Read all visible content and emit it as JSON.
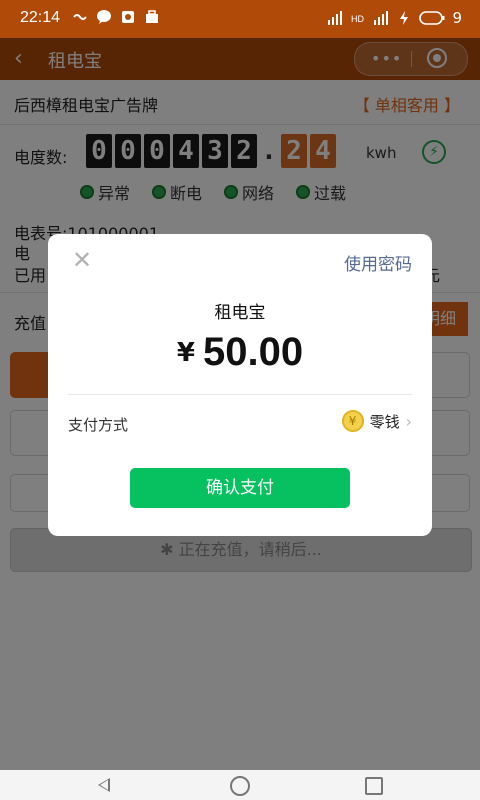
{
  "status_bar": {
    "time": "22:14",
    "battery": "9",
    "network": "4G"
  },
  "titlebar": {
    "title": "租电宝"
  },
  "device": {
    "name": "后西樟租电宝广告牌",
    "mode": "【 单相客用 】"
  },
  "meter": {
    "label": "电度数:",
    "digits": [
      "0",
      "0",
      "0",
      "4",
      "3",
      "2",
      ".",
      "2",
      "4"
    ],
    "unit": "kwh"
  },
  "indicators": [
    {
      "label": "异常",
      "color": "#2ea94b"
    },
    {
      "label": "断电",
      "color": "#2ea94b"
    },
    {
      "label": "网络",
      "color": "#2ea94b"
    },
    {
      "label": "过载",
      "color": "#2ea94b"
    }
  ],
  "info": {
    "meter_no": "电表号:101000001",
    "elec": "电",
    "used": "已用",
    "tail": "元"
  },
  "recharge": {
    "label": "充值",
    "detail_button": "明细"
  },
  "charging_button": "正在充值，请稍后...",
  "dialog": {
    "use_password": "使用密码",
    "merchant": "租电宝",
    "currency": "¥",
    "amount": "50.00",
    "pay_method_label": "支付方式",
    "pay_method_value": "零钱",
    "confirm_button": "确认支付"
  }
}
